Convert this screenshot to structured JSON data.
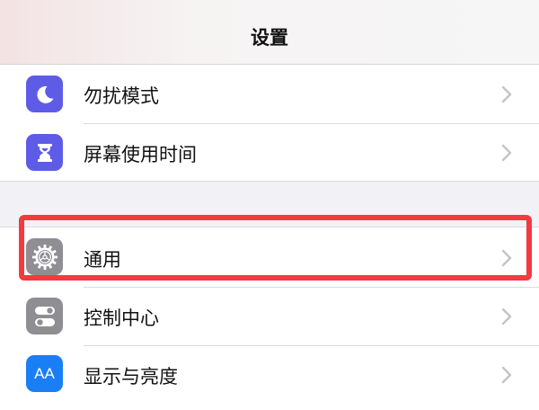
{
  "header": {
    "title": "设置"
  },
  "group1": {
    "items": [
      {
        "label": "勿扰模式",
        "icon": "moon-icon",
        "icon_bg": "#5e5ce6"
      },
      {
        "label": "屏幕使用时间",
        "icon": "hourglass-icon",
        "icon_bg": "#5e5ce6"
      }
    ]
  },
  "group2": {
    "items": [
      {
        "label": "通用",
        "icon": "gear-icon",
        "icon_bg": "#8e8e93",
        "highlighted": true
      },
      {
        "label": "控制中心",
        "icon": "toggles-icon",
        "icon_bg": "#8e8e93"
      },
      {
        "label": "显示与亮度",
        "icon": "text-size-icon",
        "icon_bg": "#1a7ef5",
        "icon_text": "AA"
      }
    ]
  },
  "colors": {
    "highlight": "#f23a3f",
    "chevron": "#c4c4c7",
    "background": "#f2f2f6"
  }
}
